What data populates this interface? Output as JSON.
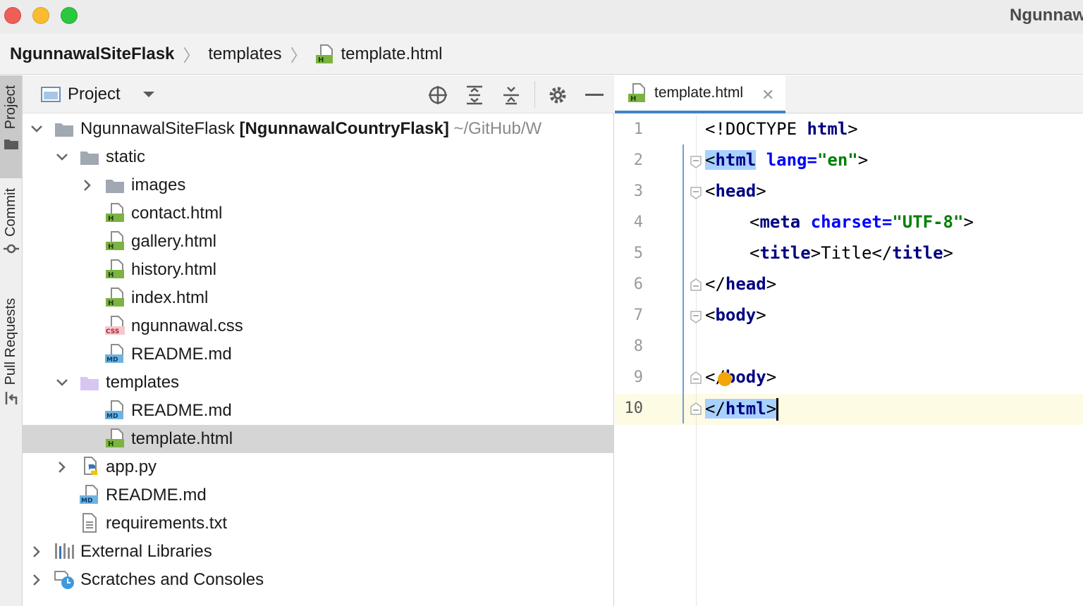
{
  "window": {
    "title": "Ngunnaw"
  },
  "breadcrumb": {
    "items": [
      {
        "label": "NgunnawalSiteFlask",
        "icon": null
      },
      {
        "label": "templates",
        "icon": null
      },
      {
        "label": "template.html",
        "icon": "html-file-icon"
      }
    ]
  },
  "tool_stripe": {
    "items": [
      {
        "label": "Project",
        "icon": "folder-icon",
        "active": true
      },
      {
        "label": "Commit",
        "icon": "commit-icon",
        "active": false
      },
      {
        "label": "Pull Requests",
        "icon": "pull-request-icon",
        "active": false
      }
    ]
  },
  "project_panel": {
    "title": "Project",
    "tree": [
      {
        "label": "NgunnawalSiteFlask",
        "bold_suffix": "[NgunnawalCountryFlask]",
        "path": "~/GitHub/W",
        "type": "folder",
        "expanded": true
      },
      {
        "label": "static",
        "type": "folder",
        "expanded": true
      },
      {
        "label": "images",
        "type": "folder",
        "expanded": false
      },
      {
        "label": "contact.html",
        "type": "html"
      },
      {
        "label": "gallery.html",
        "type": "html"
      },
      {
        "label": "history.html",
        "type": "html"
      },
      {
        "label": "index.html",
        "type": "html"
      },
      {
        "label": "ngunnawal.css",
        "type": "css"
      },
      {
        "label": "README.md",
        "type": "md"
      },
      {
        "label": "templates",
        "type": "templates-folder",
        "expanded": true
      },
      {
        "label": "README.md",
        "type": "md"
      },
      {
        "label": "template.html",
        "type": "html",
        "selected": true
      },
      {
        "label": "app.py",
        "type": "python",
        "expanded": false
      },
      {
        "label": "README.md",
        "type": "md"
      },
      {
        "label": "requirements.txt",
        "type": "txt"
      },
      {
        "label": "External Libraries",
        "type": "libraries",
        "expanded": false
      },
      {
        "label": "Scratches and Consoles",
        "type": "scratches",
        "expanded": false
      }
    ]
  },
  "editor": {
    "tab_label": "template.html",
    "line_numbers": [
      "1",
      "2",
      "3",
      "4",
      "5",
      "6",
      "7",
      "8",
      "9",
      "10"
    ],
    "current_line": "10",
    "lines": {
      "l1": {
        "a": "<!DOCTYPE ",
        "b": "html",
        "c": ">"
      },
      "l2": {
        "a": "<",
        "b": "html",
        "c": " ",
        "d": "lang",
        "e": "=",
        "f": "\"en\"",
        "g": ">"
      },
      "l3": {
        "a": "<",
        "b": "head",
        "c": ">"
      },
      "l4": {
        "a": "<",
        "b": "meta",
        "c": " ",
        "d": "charset",
        "e": "=",
        "f": "\"UTF-8\"",
        "g": ">"
      },
      "l5": {
        "a": "<",
        "b": "title",
        "c": ">Title</",
        "d": "title",
        "e": ">"
      },
      "l6": {
        "a": "</",
        "b": "head",
        "c": ">"
      },
      "l7": {
        "a": "<",
        "b": "body",
        "c": ">"
      },
      "l9": {
        "a": "</",
        "b": "body",
        "c": ">"
      },
      "l10": {
        "a": "</",
        "b": "html",
        "c": ">"
      }
    }
  },
  "colors": {
    "accent": "#4083c9",
    "tag": "#000080",
    "attribute": "#0000ff",
    "string": "#008000",
    "selection": "#a8d1ff",
    "caret_line": "#fefbe4"
  }
}
